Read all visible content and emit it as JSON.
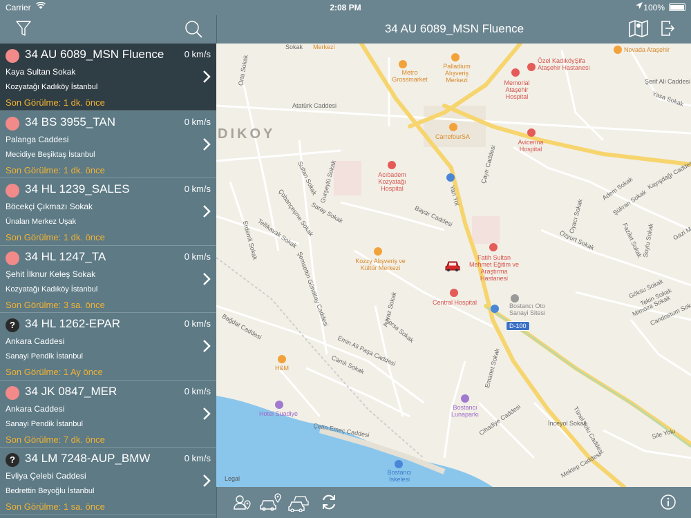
{
  "status_bar": {
    "carrier": "Carrier",
    "time": "2:08 PM",
    "battery": "100%"
  },
  "header": {
    "title": "34 AU 6089_MSN Fluence"
  },
  "vehicles": [
    {
      "plate": "34 AU 6089_MSN Fluence",
      "speed": "0 km/s",
      "street": "Kaya Sultan Sokak",
      "city": "Kozyatağı Kadıköy İstanbul",
      "seen": "Son Görülme: 1 dk. önce",
      "status": "dot"
    },
    {
      "plate": "34 BS 3955_TAN",
      "speed": "0 km/s",
      "street": "Palanga Caddesi",
      "city": "Mecidiye Beşiktaş İstanbul",
      "seen": "Son Görülme: 1 dk. önce",
      "status": "dot"
    },
    {
      "plate": "34 HL 1239_SALES",
      "speed": "0 km/s",
      "street": "Böcekçi Çıkmazı Sokak",
      "city": "Ünalan Merkez Uşak",
      "seen": "Son Görülme: 1 dk. önce",
      "status": "dot"
    },
    {
      "plate": "34 HL 1247_TA",
      "speed": "0 km/s",
      "street": "Şehit İlknur Keleş Sokak",
      "city": "Kozyatağı Kadıköy İstanbul",
      "seen": "Son Görülme: 3 sa. önce",
      "status": "dot"
    },
    {
      "plate": "34 HL 1262-EPAR",
      "speed": "0 km/s",
      "street": "Ankara Caddesi",
      "city": "Sanayi Pendik İstanbul",
      "seen": "Son Görülme: 1 Ay önce",
      "status": "unknown"
    },
    {
      "plate": "34 JK 0847_MER",
      "speed": "0 km/s",
      "street": "Ankara Caddesi",
      "city": "Sanayi Pendik İstanbul",
      "seen": "Son Görülme: 7 dk. önce",
      "status": "dot"
    },
    {
      "plate": "34 LM 7248-AUP_BMW",
      "speed": "0 km/s",
      "street": "Evliya Çelebi Caddesi",
      "city": "Bedrettin Beyoğlu İstanbul",
      "seen": "Son Görülme: 1 sa. önce",
      "status": "unknown"
    }
  ],
  "map": {
    "district": "DIKOY",
    "legal": "Legal",
    "route_badge": "D-100",
    "streets": {
      "s1": "Atatürk Caddesi",
      "s2": "Orta Sokak",
      "s3": "Merkezi",
      "s4": "Sokak",
      "s5": "Bayar Caddesi",
      "s6": "Yan Yol",
      "s7": "Çayır Caddesi",
      "s8": "Kayışdağı Caddesi",
      "s9": "Şemsettin Günaltay Caddesi",
      "s10": "Bağdat Caddesi",
      "s11": "Emin Ali Paşa Caddesi",
      "s12": "Çetin Emeç Caddesi",
      "s13": "Tünel Yolu Caddesi",
      "s14": "İnceyol Sokak",
      "s15": "Mektep Caddesi",
      "s16": "Özyurt Sokak",
      "s17": "Fazilet Sokak",
      "s18": "Yasa Sokak",
      "s19": "Şerif Ali Caddesi",
      "s20": "Saray Sokak",
      "s21": "Gurşeylü Sokak",
      "s22": "Sultan Sokak",
      "s23": "Camlı Sokak",
      "s24": "Forsa Sokak",
      "s25": "Emanet Sokak",
      "s26": "Cihadiye Caddesi",
      "s27": "Ayvaz Sokak",
      "s28": "Tellikavak Sokak",
      "s29": "Çobançeşme Sokak",
      "s30": "Adem Sokak",
      "s31": "Şükran Sokak",
      "s32": "Oyacı Sokak",
      "s33": "Göksu Sokak",
      "s34": "Mimoza Sokak",
      "s35": "Tekin Sokak",
      "s36": "Candostum Sokak",
      "s37": "Sile Yolu",
      "s38": "Erdemli Sokak",
      "s39": "Soylu Sokak",
      "s40": "Gazi M"
    },
    "pois": {
      "p1": "Metro Grossmarket",
      "p2": "Palladium Alışveriş Merkezi",
      "p3": "Memorial Ataşehir Hospital",
      "p4": "Özel KadıköyŞifa Ataşehir Hastanesi",
      "p5": "Novada Ataşehir",
      "p6": "CarrefourSA",
      "p7": "Avicenna Hospital",
      "p8": "Acıbadem Kozyatağı Hospital",
      "p9": "Kozzy Alışveriş ve Kültür Merkezi",
      "p10": "Fatih Sultan Mehmet Eğitim ve Araştırma Hastanesi",
      "p11": "Central Hospital",
      "p12": "Bostancı Oto Sanayi Sitesi",
      "p13": "H&M",
      "p14": "Hotel Suadiye",
      "p15": "Bostancı Lunaparkı",
      "p16": "Bostancı İskelesi"
    }
  },
  "colors": {
    "header": "#6b8590",
    "list_bg": "#5d7a85",
    "selected_row": "#2f3d44",
    "status_dot": "#f28a8a",
    "last_seen": "#f2b233",
    "water": "#8ac6ec",
    "highway": "#f7d56e"
  },
  "icons": [
    "filter-icon",
    "search-icon",
    "map-icon",
    "exit-icon",
    "chevron-right-icon",
    "car-marker-icon",
    "pin-location-icon",
    "car-location-icon",
    "cars-icon",
    "refresh-icon",
    "info-icon"
  ]
}
